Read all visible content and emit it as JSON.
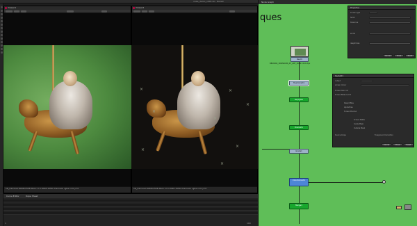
{
  "window": {
    "title": "nuke_demo_v001.nk - NukeX",
    "accent": "#5fbe58"
  },
  "left_toolbar": {
    "tools": [
      "draw-icon",
      "node-icon",
      "transform-icon",
      "keyer-icon",
      "color-icon",
      "merge-icon",
      "filter-icon",
      "3d-icon",
      "views-icon",
      "metadata-icon",
      "particles-icon",
      "deep-icon",
      "toolsets-icon",
      "other-icon"
    ]
  },
  "viewers": [
    {
      "tab": "Viewer1",
      "info": "1K_Carnival 2048x1556 bbox: 0 0 2048 1556 channels: rgba x=0 y=0",
      "checker": "original plate with green screen"
    },
    {
      "tab": "Viewer2",
      "info": "1K_Carnival 2048x1556 bbox: 0 0 2048 1556 channels: rgba x=0 y=0",
      "checker": "keyed result over black"
    }
  ],
  "timeline": {
    "tabs": [
      "Curve Editor",
      "Dope Sheet"
    ],
    "frame_start": "1",
    "frame_end": "100",
    "current_frame": "1"
  },
  "node_graph": {
    "tab": "Node Graph",
    "title": "ques",
    "nodes": [
      {
        "id": "read",
        "label": "Read1",
        "sub": "BBCMAN_UNKNOWN_KY_ART_2000.1110.dpx",
        "color": "grey"
      },
      {
        "id": "hue",
        "label": "HueCorrect1",
        "color": "green"
      },
      {
        "id": "kel",
        "label": "Keylight1",
        "color": "green"
      },
      {
        "id": "pm",
        "label": "Premult1",
        "color": "green"
      },
      {
        "id": "grade",
        "label": "Grade1",
        "color": "grey"
      },
      {
        "id": "coll",
        "label": "ColorCorrect1",
        "color": "blue"
      },
      {
        "id": "merge",
        "label": "Merge1",
        "color": "green"
      }
    ]
  },
  "properties": {
    "panel_a": {
      "title": "Properties",
      "rows": [
        "screen type",
        "factor",
        "tolerance",
        "erode",
        "despill bias"
      ],
      "buttons": [
        "Cancel",
        "Close",
        "Reset"
      ]
    },
    "panel_b": {
      "title": "Keylight1",
      "rows": [
        "output",
        "screen colour",
        "Screen Gain 1.0",
        "Screen Balance 0.5",
        "Despill Bias",
        "Alpha Bias",
        "Screen Pre-blur",
        "Screen Matte",
        "Inside Mask",
        "Outside Mask",
        "Source Crops",
        "Foreground Correction"
      ],
      "buttons": [
        "Cancel",
        "Close",
        "Reset"
      ]
    }
  }
}
